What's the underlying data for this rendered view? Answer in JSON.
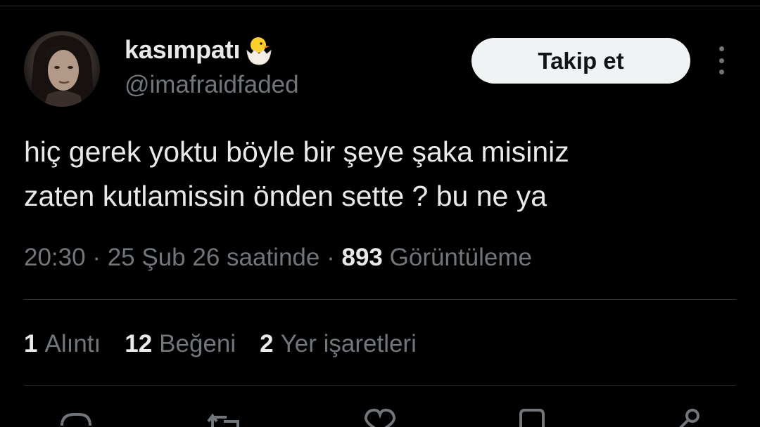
{
  "tweet": {
    "author": {
      "display_name": "kasımpatı",
      "handle": "@imafraidfaded",
      "name_emoji": "hatching-chick-emoji",
      "avatar": "profile-photo"
    },
    "follow_label": "Takip et",
    "more_icon": "more-vertical-icon",
    "text_lines": [
      "hiç gerek yoktu böyle bir şeye şaka misiniz",
      "zaten kutlamissin önden sette ? bu ne ya"
    ],
    "meta": {
      "time": "20:30",
      "date_text": "25 Şub 26 saatinde",
      "views_count": "893",
      "views_label": "Görüntüleme",
      "separator": "·"
    },
    "stats": {
      "quotes": {
        "count": "1",
        "label": "Alıntı"
      },
      "likes": {
        "count": "12",
        "label": "Beğeni"
      },
      "bookmarks": {
        "count": "2",
        "label": "Yer işaretleri"
      }
    },
    "actions": [
      "reply-icon",
      "retweet-icon",
      "like-icon",
      "bookmark-icon",
      "share-icon"
    ]
  },
  "colors": {
    "background": "#000000",
    "primary_text": "#e7e9ea",
    "secondary_text": "#71767b",
    "divider": "#2f3336",
    "button_bg": "#eff3f4",
    "button_text": "#0f1419"
  }
}
